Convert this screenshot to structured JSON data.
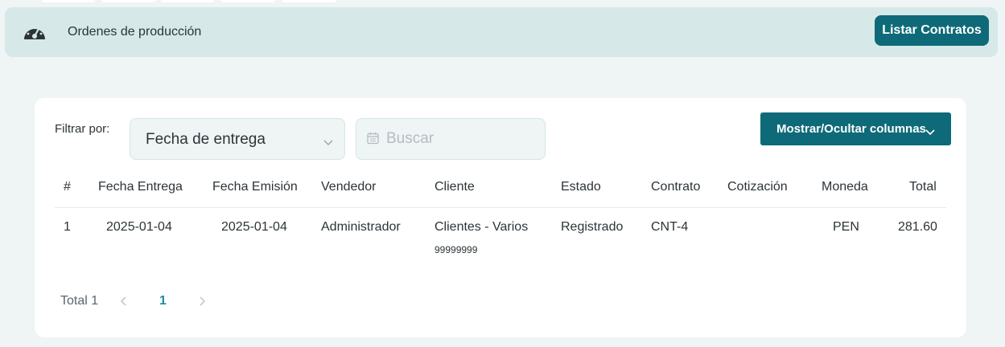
{
  "header": {
    "title": "Ordenes de producción",
    "list_button": "Listar Contratos",
    "icon": "speedometer-icon"
  },
  "filters": {
    "label": "Filtrar por:",
    "selected_field": "Fecha de entrega",
    "search_placeholder": "Buscar",
    "search_value": "",
    "columns_button": "Mostrar/Ocultar columnas"
  },
  "table": {
    "columns": [
      "#",
      "Fecha Entrega",
      "Fecha Emisión",
      "Vendedor",
      "Cliente",
      "Estado",
      "Contrato",
      "Cotización",
      "Moneda",
      "Total"
    ],
    "rows": [
      {
        "num": "1",
        "fecha_entrega": "2025-01-04",
        "fecha_emision": "2025-01-04",
        "vendedor": "Administrador",
        "cliente": "Clientes - Varios",
        "cliente_doc": "99999999",
        "estado": "Registrado",
        "contrato": "CNT-4",
        "cotizacion": "",
        "moneda": "PEN",
        "total": "281.60"
      }
    ]
  },
  "pagination": {
    "total_label": "Total 1",
    "current_page": "1"
  },
  "colors": {
    "page_bg": "#eef5f4",
    "header_bg": "#d6e9e8",
    "primary": "#0e6a78",
    "active_page": "#1b8aa0"
  }
}
